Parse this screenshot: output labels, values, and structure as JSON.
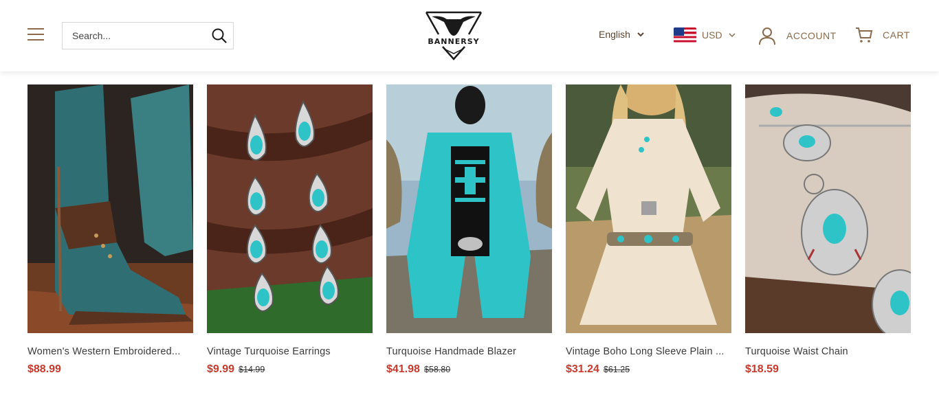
{
  "header": {
    "search_placeholder": "Search...",
    "logo_text": "BANNERSY",
    "language": "English",
    "currency": "USD",
    "account_label": "ACCOUNT",
    "cart_label": "CART"
  },
  "colors": {
    "accent_brown": "#8a6a4a",
    "price_red": "#c8392b",
    "turquoise": "#2ec4c7"
  },
  "products": [
    {
      "title": "Women's Western Embroidered...",
      "price": "$88.99",
      "old_price": ""
    },
    {
      "title": "Vintage Turquoise Earrings",
      "price": "$9.99",
      "old_price": "$14.99"
    },
    {
      "title": "Turquoise Handmade Blazer",
      "price": "$41.98",
      "old_price": "$58.80"
    },
    {
      "title": "Vintage Boho Long Sleeve Plain ...",
      "price": "$31.24",
      "old_price": "$61.25"
    },
    {
      "title": "Turquoise Waist Chain",
      "price": "$18.59",
      "old_price": ""
    }
  ]
}
